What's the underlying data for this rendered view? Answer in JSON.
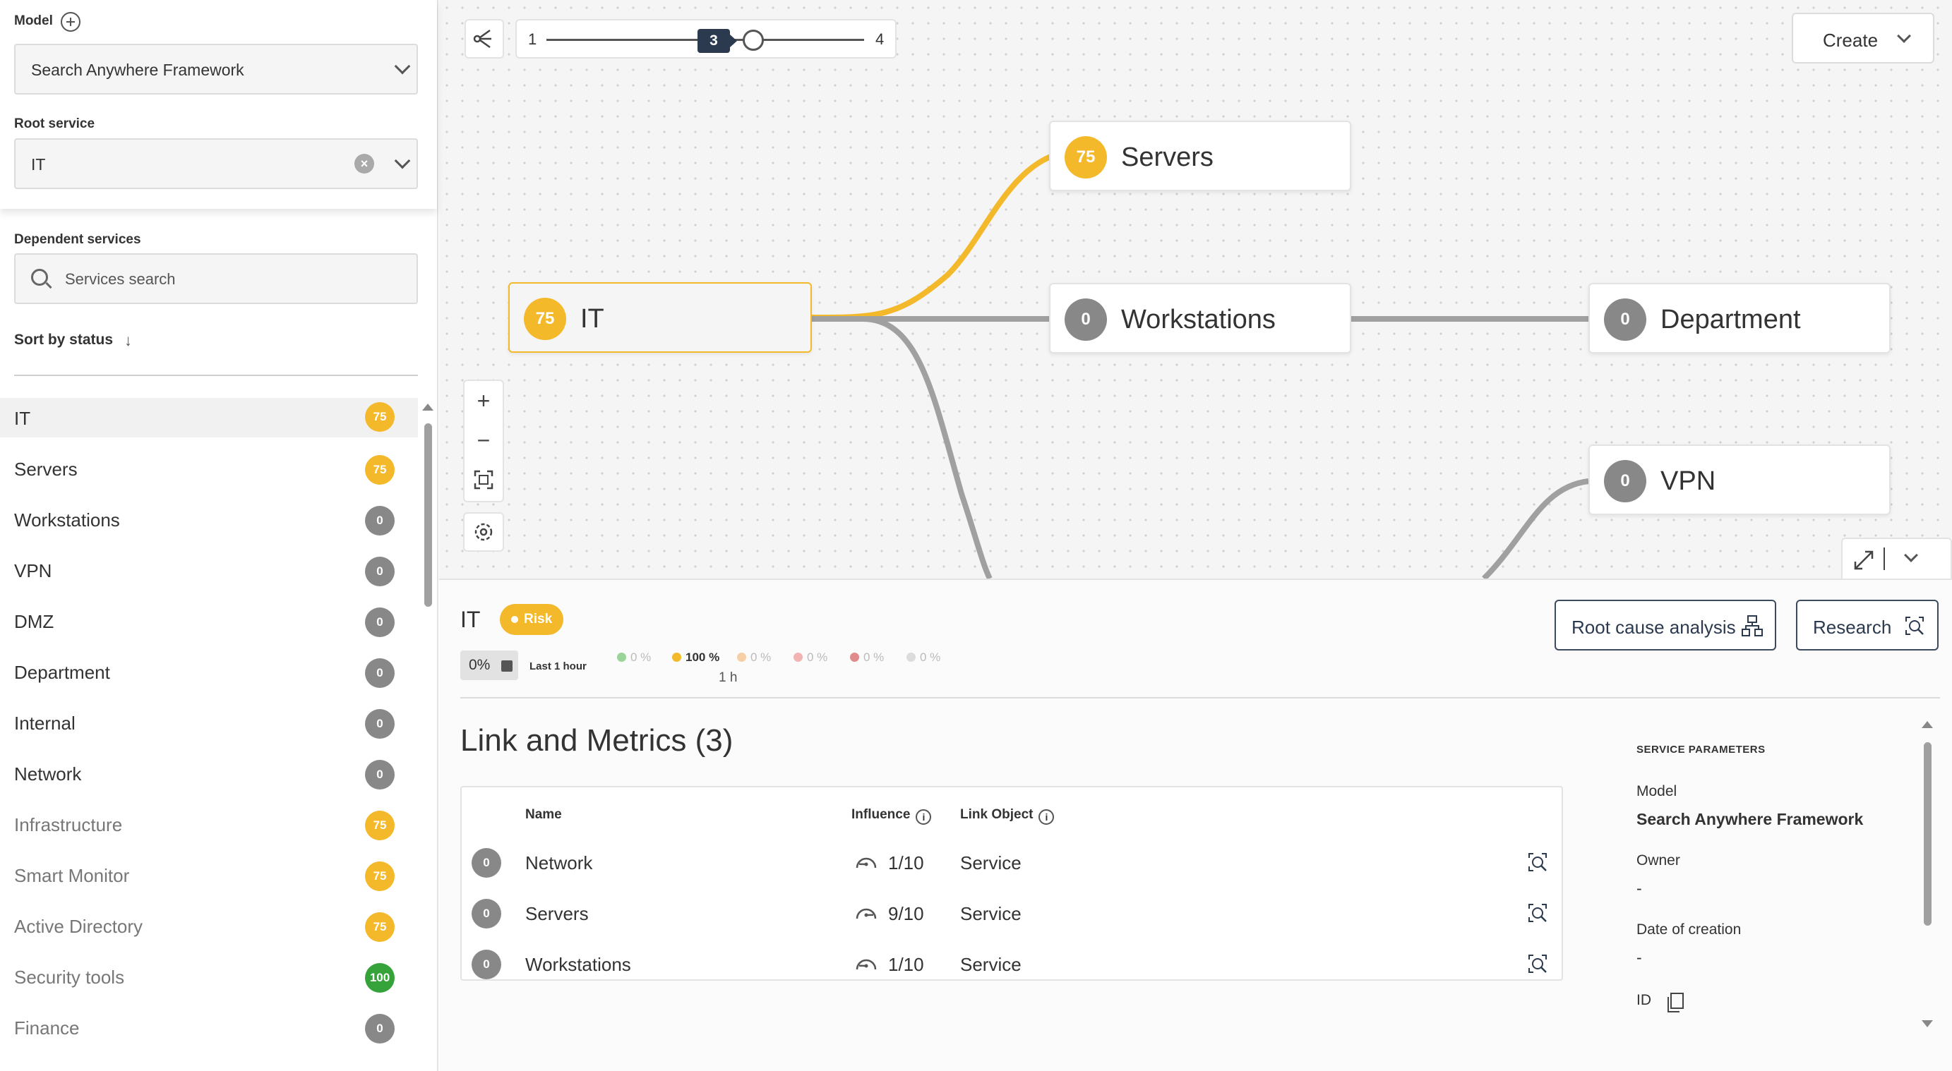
{
  "sidebar": {
    "model_label": "Model",
    "model_value": "Search Anywhere Framework",
    "root_label": "Root service",
    "root_value": "IT",
    "dependent_label": "Dependent services",
    "search_placeholder": "Services search",
    "sort_label": "Sort by status",
    "services": [
      {
        "name": "IT",
        "score": "75",
        "color": "#f4b92b",
        "muted": false
      },
      {
        "name": "Servers",
        "score": "75",
        "color": "#f4b92b",
        "muted": false
      },
      {
        "name": "Workstations",
        "score": "0",
        "color": "#888888",
        "muted": false
      },
      {
        "name": "VPN",
        "score": "0",
        "color": "#888888",
        "muted": false
      },
      {
        "name": "DMZ",
        "score": "0",
        "color": "#888888",
        "muted": false
      },
      {
        "name": "Department",
        "score": "0",
        "color": "#888888",
        "muted": false
      },
      {
        "name": "Internal",
        "score": "0",
        "color": "#888888",
        "muted": false
      },
      {
        "name": "Network",
        "score": "0",
        "color": "#888888",
        "muted": false
      },
      {
        "name": "Infrastructure",
        "score": "75",
        "color": "#f4b92b",
        "muted": true
      },
      {
        "name": "Smart Monitor",
        "score": "75",
        "color": "#f4b92b",
        "muted": true
      },
      {
        "name": "Active Directory",
        "score": "75",
        "color": "#f4b92b",
        "muted": true
      },
      {
        "name": "Security tools",
        "score": "100",
        "color": "#36a33a",
        "muted": true
      },
      {
        "name": "Finance",
        "score": "0",
        "color": "#888888",
        "muted": true
      }
    ]
  },
  "toolbar": {
    "depth_min": "1",
    "depth_max": "4",
    "depth_value": "3",
    "create_label": "Create"
  },
  "graph": {
    "nodes": {
      "it": {
        "label": "IT",
        "score": "75"
      },
      "servers": {
        "label": "Servers",
        "score": "75"
      },
      "workstations": {
        "label": "Workstations",
        "score": "0"
      },
      "department": {
        "label": "Department",
        "score": "0"
      },
      "vpn": {
        "label": "VPN",
        "score": "0"
      }
    }
  },
  "details": {
    "title": "IT",
    "status": "Risk",
    "availability": "0%",
    "period": "Last 1 hour",
    "stats": [
      {
        "value": "0 %",
        "color": "#9ad49a",
        "active": false
      },
      {
        "value": "100 %",
        "color": "#f4b92b",
        "active": true
      },
      {
        "value": "0 %",
        "color": "#f6cfa6",
        "active": false
      },
      {
        "value": "0 %",
        "color": "#f2b3b3",
        "active": false
      },
      {
        "value": "0 %",
        "color": "#e08a8a",
        "active": false
      },
      {
        "value": "0 %",
        "color": "#dcdcdc",
        "active": false
      }
    ],
    "stat_sub": "1 h",
    "rca_label": "Root cause analysis",
    "research_label": "Research",
    "links_title": "Link and Metrics (3)",
    "columns": {
      "name": "Name",
      "influence": "Influence",
      "link_object": "Link Object"
    },
    "rows": [
      {
        "score": "0",
        "name": "Network",
        "influence": "1/10",
        "object": "Service"
      },
      {
        "score": "0",
        "name": "Servers",
        "influence": "9/10",
        "object": "Service"
      },
      {
        "score": "0",
        "name": "Workstations",
        "influence": "1/10",
        "object": "Service"
      }
    ],
    "params": {
      "heading": "SERVICE PARAMETERS",
      "model_label": "Model",
      "model_value": "Search Anywhere Framework",
      "owner_label": "Owner",
      "owner_value": "-",
      "date_label": "Date of creation",
      "date_value": "-",
      "id_label": "ID"
    }
  },
  "colors": {
    "accent_yellow": "#f4b92b",
    "neutral_grey": "#888888",
    "ok_green": "#36a33a",
    "navy": "#2c3a4f"
  }
}
